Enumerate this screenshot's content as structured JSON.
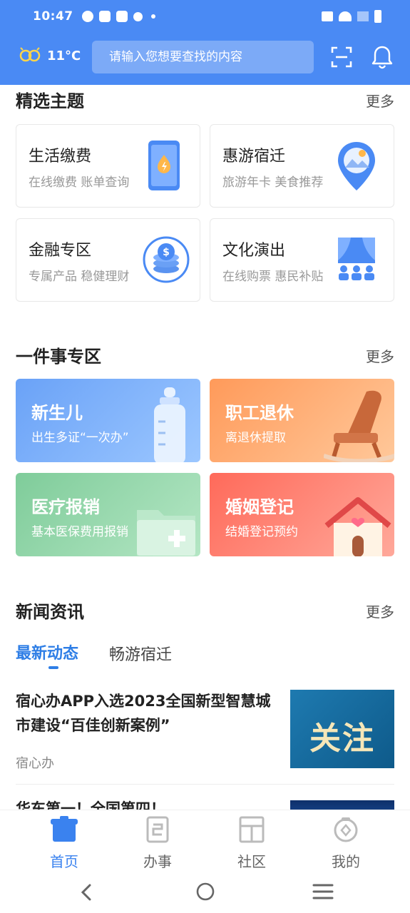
{
  "status_bar": {
    "time": "10:47"
  },
  "header": {
    "temperature": "11°C",
    "search_placeholder": "请输入您想要查找的内容",
    "accent": "#4a8af4"
  },
  "featured": {
    "title": "精选主题",
    "more": "更多",
    "cards": [
      {
        "title": "生活缴费",
        "subtitle": "在线缴费 账单查询",
        "icon": "phone-bill-icon"
      },
      {
        "title": "惠游宿迁",
        "subtitle": "旅游年卡 美食推荐",
        "icon": "location-pin-icon"
      },
      {
        "title": "金融专区",
        "subtitle": "专属产品 稳健理财",
        "icon": "coins-icon"
      },
      {
        "title": "文化演出",
        "subtitle": "在线购票 惠民补贴",
        "icon": "theater-icon"
      }
    ]
  },
  "one_thing": {
    "title": "一件事专区",
    "more": "更多",
    "cards": [
      {
        "title": "新生儿",
        "subtitle": "出生多证“一次办”",
        "color": "#7fb4ff"
      },
      {
        "title": "职工退休",
        "subtitle": "离退休提取",
        "color": "#ffa96a"
      },
      {
        "title": "医疗报销",
        "subtitle": "基本医保费用报销",
        "color": "#8ed3a5"
      },
      {
        "title": "婚姻登记",
        "subtitle": "结婚登记预约",
        "color": "#ff8a7a"
      }
    ]
  },
  "news": {
    "title": "新闻资讯",
    "more": "更多",
    "tabs": [
      "最新动态",
      "畅游宿迁"
    ],
    "items": [
      {
        "title": "宿心办APP入选2023全国新型智慧城市建设“百佳创新案例”",
        "source": "宿心办",
        "thumb_text": "关注"
      },
      {
        "title": "华东第一！全国第四！"
      }
    ]
  },
  "bottom_nav": {
    "items": [
      {
        "label": "首页",
        "active": true
      },
      {
        "label": "办事",
        "active": false
      },
      {
        "label": "社区",
        "active": false
      },
      {
        "label": "我的",
        "active": false
      }
    ]
  }
}
